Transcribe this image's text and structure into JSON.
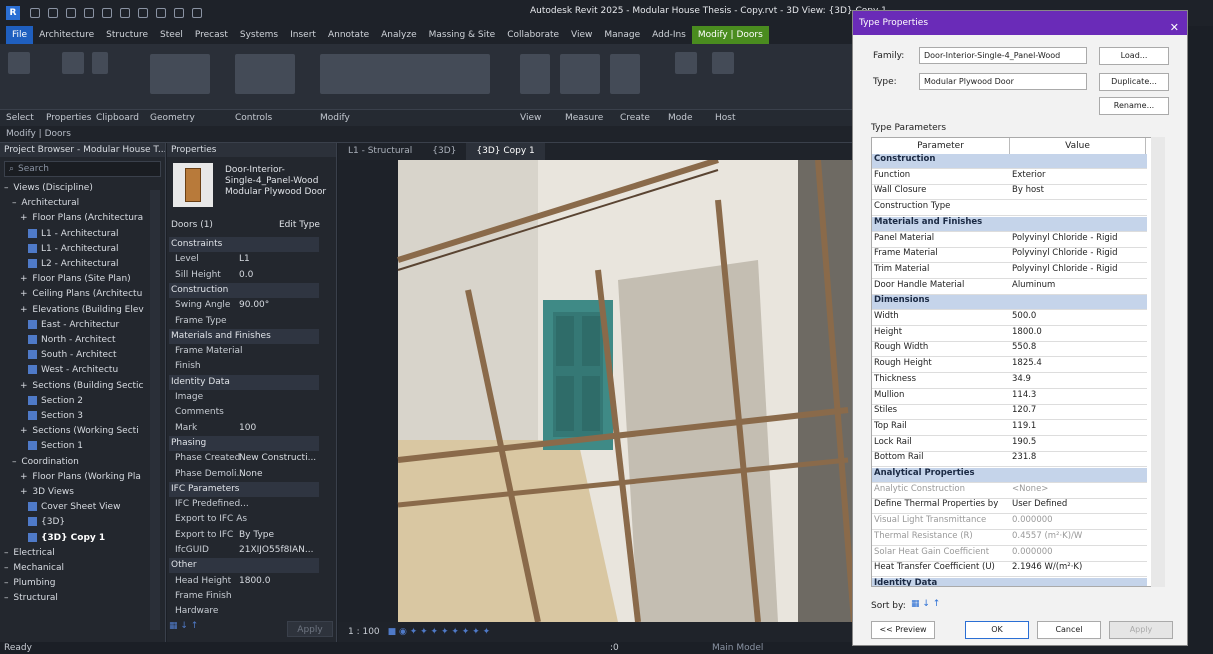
{
  "app_title": "Autodesk Revit 2025 - Modular House Thesis - Copy.rvt - 3D View: {3D} Copy 1",
  "ribbon_tabs": [
    "File",
    "Architecture",
    "Structure",
    "Steel",
    "Precast",
    "Systems",
    "Insert",
    "Annotate",
    "Analyze",
    "Massing & Site",
    "Collaborate",
    "View",
    "Manage",
    "Add-Ins",
    "Modify | Doors"
  ],
  "ribbon_groups": [
    "Select",
    "Properties",
    "Clipboard",
    "Geometry",
    "Controls",
    "Modify",
    "View",
    "Measure",
    "Create",
    "Mode",
    "Host"
  ],
  "context_label": "Modify | Doors",
  "project_browser": {
    "title": "Project Browser - Modular House T...",
    "search": "Search",
    "items": [
      {
        "label": "Views (Discipline)",
        "level": 0,
        "icon": false
      },
      {
        "label": "Architectural",
        "level": 1,
        "icon": false
      },
      {
        "label": "Floor Plans (Architectura",
        "level": 2,
        "icon": false
      },
      {
        "label": "L1 - Architectural",
        "level": 3,
        "icon": true
      },
      {
        "label": "L1 - Architectural",
        "level": 3,
        "icon": true
      },
      {
        "label": "L2 - Architectural",
        "level": 3,
        "icon": true
      },
      {
        "label": "Floor Plans (Site Plan)",
        "level": 2,
        "icon": false
      },
      {
        "label": "Ceiling Plans (Architectu",
        "level": 2,
        "icon": false
      },
      {
        "label": "Elevations (Building Elev",
        "level": 2,
        "icon": false
      },
      {
        "label": "East - Architectur",
        "level": 3,
        "icon": true
      },
      {
        "label": "North - Architect",
        "level": 3,
        "icon": true
      },
      {
        "label": "South - Architect",
        "level": 3,
        "icon": true
      },
      {
        "label": "West - Architectu",
        "level": 3,
        "icon": true
      },
      {
        "label": "Sections (Building Sectic",
        "level": 2,
        "icon": false
      },
      {
        "label": "Section 2",
        "level": 3,
        "icon": true
      },
      {
        "label": "Section 3",
        "level": 3,
        "icon": true
      },
      {
        "label": "Sections (Working Secti",
        "level": 2,
        "icon": false
      },
      {
        "label": "Section 1",
        "level": 3,
        "icon": true
      },
      {
        "label": "Coordination",
        "level": 1,
        "icon": false
      },
      {
        "label": "Floor Plans (Working Pla",
        "level": 2,
        "icon": false
      },
      {
        "label": "3D Views",
        "level": 2,
        "icon": false
      },
      {
        "label": "Cover Sheet View",
        "level": 3,
        "icon": true
      },
      {
        "label": "{3D}",
        "level": 3,
        "icon": true
      },
      {
        "label": "{3D} Copy 1",
        "level": 3,
        "icon": true,
        "selected": true
      },
      {
        "label": "Electrical",
        "level": 0,
        "icon": false
      },
      {
        "label": "Mechanical",
        "level": 0,
        "icon": false
      },
      {
        "label": "Plumbing",
        "level": 0,
        "icon": false
      },
      {
        "label": "Structural",
        "level": 0,
        "icon": false
      }
    ]
  },
  "properties": {
    "title": "Properties",
    "family_line1": "Door-Interior-",
    "family_line2": "Single-4_Panel-Wood",
    "family_line3": "Modular Plywood Door",
    "selector": "Doors (1)",
    "edit_type": "Edit Type",
    "rows": [
      {
        "cat": "Constraints"
      },
      {
        "k": "Level",
        "v": "L1"
      },
      {
        "k": "Sill Height",
        "v": "0.0"
      },
      {
        "cat": "Construction"
      },
      {
        "k": "Swing Angle",
        "v": "90.00°"
      },
      {
        "k": "Frame Type",
        "v": ""
      },
      {
        "cat": "Materials and Finishes"
      },
      {
        "k": "Frame Material",
        "v": ""
      },
      {
        "k": "Finish",
        "v": ""
      },
      {
        "cat": "Identity Data"
      },
      {
        "k": "Image",
        "v": ""
      },
      {
        "k": "Comments",
        "v": ""
      },
      {
        "k": "Mark",
        "v": "100"
      },
      {
        "cat": "Phasing"
      },
      {
        "k": "Phase Created",
        "v": "New Constructi..."
      },
      {
        "k": "Phase Demoli...",
        "v": "None"
      },
      {
        "cat": "IFC Parameters"
      },
      {
        "k": "IFC Predefined...",
        "v": ""
      },
      {
        "k": "Export to IFC As",
        "v": ""
      },
      {
        "k": "Export to IFC",
        "v": "By Type"
      },
      {
        "k": "IfcGUID",
        "v": "21XIJO55f8IAN..."
      },
      {
        "cat": "Other"
      },
      {
        "k": "Head Height",
        "v": "1800.0"
      },
      {
        "k": "Frame Finish",
        "v": ""
      },
      {
        "k": "Hardware",
        "v": ""
      }
    ],
    "apply": "Apply"
  },
  "view_tabs": [
    {
      "label": "L1 - Structural",
      "active": false
    },
    {
      "label": "{3D}",
      "active": false
    },
    {
      "label": "{3D} Copy 1",
      "active": true
    }
  ],
  "view_scale": "1 : 100",
  "status": {
    "left": "Ready",
    "model": "Main Model",
    "count": ":0"
  },
  "dialog": {
    "title": "Type Properties",
    "family_label": "Family:",
    "family_value": "Door-Interior-Single-4_Panel-Wood",
    "type_label": "Type:",
    "type_value": "Modular Plywood Door",
    "load": "Load...",
    "duplicate": "Duplicate...",
    "rename": "Rename...",
    "type_params": "Type Parameters",
    "col_param": "Parameter",
    "col_value": "Value",
    "rows": [
      {
        "grp": "Construction"
      },
      {
        "p": "Function",
        "v": "Exterior"
      },
      {
        "p": "Wall Closure",
        "v": "By host"
      },
      {
        "p": "Construction Type",
        "v": ""
      },
      {
        "grp": "Materials and Finishes"
      },
      {
        "p": "Panel Material",
        "v": "Polyvinyl Chloride - Rigid"
      },
      {
        "p": "Frame Material",
        "v": "Polyvinyl Chloride - Rigid"
      },
      {
        "p": "Trim Material",
        "v": "Polyvinyl Chloride - Rigid"
      },
      {
        "p": "Door Handle Material",
        "v": "Aluminum"
      },
      {
        "grp": "Dimensions"
      },
      {
        "p": "Width",
        "v": "500.0"
      },
      {
        "p": "Height",
        "v": "1800.0"
      },
      {
        "p": "Rough Width",
        "v": "550.8"
      },
      {
        "p": "Rough Height",
        "v": "1825.4"
      },
      {
        "p": "Thickness",
        "v": "34.9"
      },
      {
        "p": "Mullion",
        "v": "114.3"
      },
      {
        "p": "Stiles",
        "v": "120.7"
      },
      {
        "p": "Top Rail",
        "v": "119.1"
      },
      {
        "p": "Lock Rail",
        "v": "190.5"
      },
      {
        "p": "Bottom Rail",
        "v": "231.8"
      },
      {
        "grp": "Analytical Properties"
      },
      {
        "p": "Analytic Construction",
        "v": "<None>",
        "dim": true
      },
      {
        "p": "Define Thermal Properties by",
        "v": "User Defined"
      },
      {
        "p": "Visual Light Transmittance",
        "v": "0.000000",
        "dim": true
      },
      {
        "p": "Thermal Resistance (R)",
        "v": "0.4557 (m²·K)/W",
        "dim": true
      },
      {
        "p": "Solar Heat Gain Coefficient",
        "v": "0.000000",
        "dim": true
      },
      {
        "p": "Heat Transfer Coefficient (U)",
        "v": "2.1946 W/(m²·K)"
      },
      {
        "grp": "Identity Data"
      }
    ],
    "sort_by": "Sort by:",
    "preview": "<< Preview",
    "ok": "OK",
    "cancel": "Cancel",
    "apply": "Apply"
  }
}
